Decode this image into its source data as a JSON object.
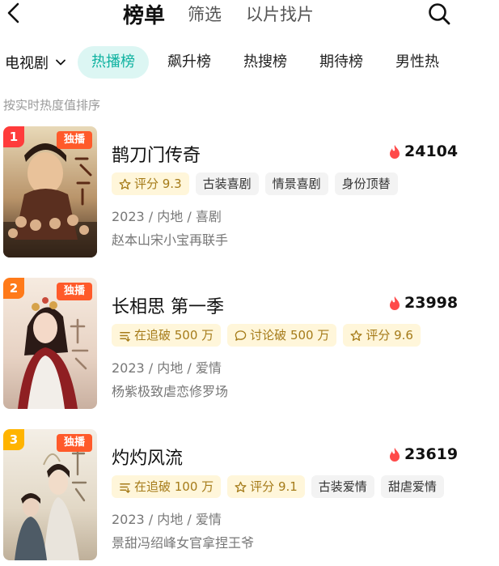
{
  "nav": {
    "tabs": [
      "榜单",
      "筛选",
      "以片找片"
    ]
  },
  "category": {
    "selected": "电视剧",
    "tabs": [
      "热播榜",
      "飙升榜",
      "热搜榜",
      "期待榜",
      "男性热"
    ]
  },
  "sort_hint": "按实时热度值排序",
  "exclusive_label": "独播",
  "colors": {
    "accent": "#0fb2a0",
    "rank1": "#ff3b3b",
    "rank2": "#ff7a1a",
    "rank3": "#ffb400",
    "flame": "#ff4a4a"
  },
  "items": [
    {
      "rank": "1",
      "title": "鹊刀门传奇",
      "heat": "24104",
      "tags": [
        {
          "icon": "star-icon",
          "text": "评分 9.3",
          "style": "gold"
        },
        {
          "text": "古装喜剧"
        },
        {
          "text": "情景喜剧"
        },
        {
          "text": "身份顶替"
        }
      ],
      "meta": "2023 / 内地 / 喜剧",
      "desc": "赵本山宋小宝再联手"
    },
    {
      "rank": "2",
      "title": "长相思 第一季",
      "heat": "23998",
      "tags": [
        {
          "icon": "list-icon",
          "text": "在追破 500 万",
          "style": "gold"
        },
        {
          "icon": "comment-icon",
          "text": "讨论破 500 万",
          "style": "gold"
        },
        {
          "icon": "star-icon",
          "text": "评分 9.6",
          "style": "gold"
        }
      ],
      "meta": "2023 / 内地 / 爱情",
      "desc": "杨紫极致虐恋修罗场"
    },
    {
      "rank": "3",
      "title": "灼灼风流",
      "heat": "23619",
      "tags": [
        {
          "icon": "list-icon",
          "text": "在追破 100 万",
          "style": "gold"
        },
        {
          "icon": "star-icon",
          "text": "评分 9.1",
          "style": "gold"
        },
        {
          "text": "古装爱情"
        },
        {
          "text": "甜虐爱情"
        }
      ],
      "meta": "2023 / 内地 / 爱情",
      "desc": "景甜冯绍峰女官拿捏王爷"
    }
  ]
}
